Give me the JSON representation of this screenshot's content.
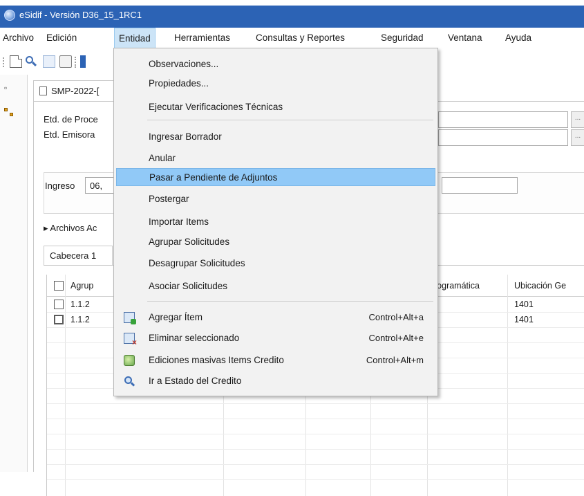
{
  "window": {
    "title": "eSidif - Versión D36_15_1RC1"
  },
  "menubar": {
    "items": [
      {
        "label": "Archivo"
      },
      {
        "label": "Edición"
      },
      {
        "label": "Entidad"
      },
      {
        "label": "Herramientas"
      },
      {
        "label": "Consultas y Reportes"
      },
      {
        "label": "Seguridad"
      },
      {
        "label": "Ventana"
      },
      {
        "label": "Ayuda"
      }
    ]
  },
  "editor": {
    "tab_label": "SMP-2022-[",
    "fields": {
      "etd_proceso_label": "Etd. de Proce",
      "etd_emisora_label": "Etd. Emisora",
      "ingreso_label": "Ingreso",
      "ingreso_value": "06,"
    },
    "archivos_label": "Archivos Ac",
    "inner_tab_label": "Cabecera 1",
    "dots_label": "...",
    "table": {
      "headers": [
        "Agrup",
        "rogramática",
        "Ubicación Ge"
      ],
      "rows": [
        {
          "agrup": "1.1.2",
          "ubicacion": "1401"
        },
        {
          "agrup": "1.1.2",
          "ubicacion": "1401"
        }
      ]
    }
  },
  "dropdown": {
    "items": [
      {
        "label": "Observaciones..."
      },
      {
        "label": "Propiedades..."
      },
      {
        "label": "Ejecutar Verificaciones Técnicas"
      },
      {
        "label": "Ingresar Borrador"
      },
      {
        "label": "Anular"
      },
      {
        "label": "Pasar a Pendiente de Adjuntos",
        "highlighted": true
      },
      {
        "label": "Postergar"
      },
      {
        "label": "Importar Items"
      },
      {
        "label": "Agrupar Solicitudes"
      },
      {
        "label": "Desagrupar Solicitudes"
      },
      {
        "label": "Asociar Solicitudes"
      },
      {
        "label": "Agregar Ítem",
        "shortcut": "Control+Alt+a",
        "icon": "add-item-icon"
      },
      {
        "label": "Eliminar seleccionado",
        "shortcut": "Control+Alt+e",
        "icon": "delete-selected-icon"
      },
      {
        "label": "Ediciones masivas Items Credito",
        "shortcut": "Control+Alt+m",
        "icon": "mass-edit-icon"
      },
      {
        "label": "Ir a Estado del Credito",
        "icon": "credit-state-search-icon"
      }
    ]
  },
  "colors": {
    "titlebar": "#2c63b5",
    "menu_active": "#cce4f7",
    "dropdown_highlight": "#91c9f7"
  }
}
